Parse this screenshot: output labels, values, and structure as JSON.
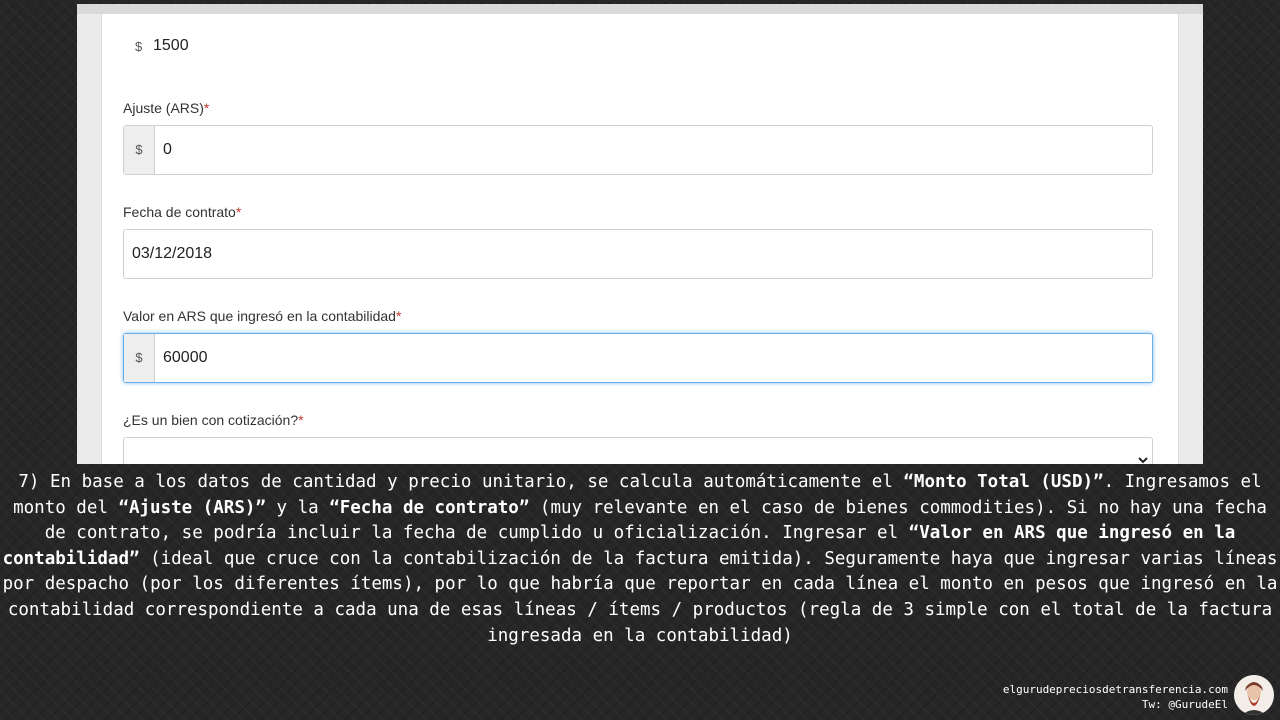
{
  "form": {
    "currency_symbol": "$",
    "top_value": "1500",
    "ajuste": {
      "label": "Ajuste (ARS)",
      "required_mark": "*",
      "value": "0"
    },
    "fecha": {
      "label": "Fecha de contrato",
      "required_mark": "*",
      "value": "03/12/2018"
    },
    "valor": {
      "label": "Valor en ARS que ingresó en la contabilidad",
      "required_mark": "*",
      "value": "60000"
    },
    "cotizacion": {
      "label": "¿Es un bien con cotización?",
      "required_mark": "*",
      "value": ""
    }
  },
  "caption": {
    "p1": "7) En base a los datos de cantidad y precio unitario, se calcula automáticamente el ",
    "b1": "“Monto Total (USD)”",
    "p2": ". Ingresamos el monto del ",
    "b2": "“Ajuste (ARS)”",
    "p3": " y la ",
    "b3": "“Fecha de contrato”",
    "p4": " (muy relevante en el caso de bienes commodities). Si no hay una fecha de contrato, se podría incluir la fecha de cumplido u oficialización. Ingresar el ",
    "b4": "“Valor en ARS que ingresó en la contabilidad”",
    "p5": " (ideal que cruce con la contabilización de la factura emitida). Seguramente haya que ingresar varias líneas por despacho (por los diferentes ítems), por lo que habría que reportar en cada línea el monto en pesos que ingresó en la contabilidad correspondiente a cada una de esas líneas / ítems / productos (regla de 3 simple con el total de la factura ingresada en la contabilidad)"
  },
  "credit": {
    "site": "elgurudepreciosdetransferencia.com",
    "twitter": "Tw: @GurudeEl"
  },
  "colors": {
    "focus_border": "#66afe9",
    "required": "#c0392b",
    "background": "#262626"
  }
}
